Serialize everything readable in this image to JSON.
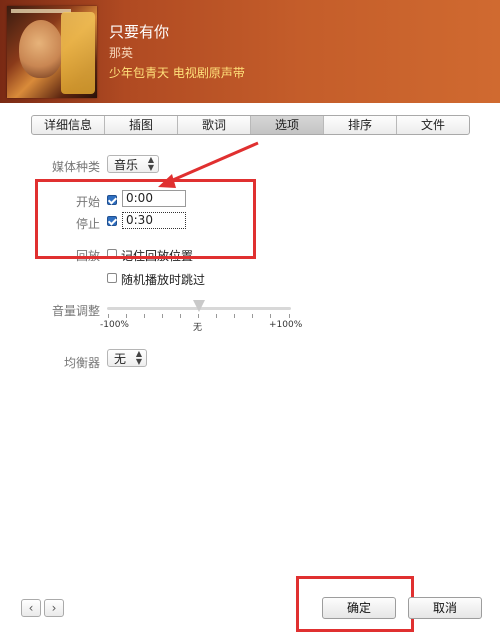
{
  "header": {
    "song_title": "只要有你",
    "artist": "那英",
    "album": "少年包青天 电视剧原声带"
  },
  "tabs": [
    {
      "label": "详细信息",
      "active": false
    },
    {
      "label": "插图",
      "active": false
    },
    {
      "label": "歌词",
      "active": false
    },
    {
      "label": "选项",
      "active": true
    },
    {
      "label": "排序",
      "active": false
    },
    {
      "label": "文件",
      "active": false
    }
  ],
  "options": {
    "media_kind_label": "媒体种类",
    "media_kind_value": "音乐",
    "start_label": "开始",
    "start_checked": true,
    "start_value": "0:00",
    "stop_label": "停止",
    "stop_checked": true,
    "stop_value": "0:30",
    "playback_label": "回放",
    "remember_position_label": "记住回放位置",
    "remember_position_checked": false,
    "skip_shuffle_label": "随机播放时跳过",
    "skip_shuffle_checked": false,
    "volume_label": "音量调整",
    "volume_min_label": "-100%",
    "volume_mid_label": "无",
    "volume_max_label": "+100%",
    "volume_value_percent": 0,
    "equalizer_label": "均衡器",
    "equalizer_value": "无"
  },
  "footer": {
    "prev_icon": "chevron-left-icon",
    "next_icon": "chevron-right-icon",
    "ok_label": "确定",
    "cancel_label": "取消"
  },
  "colors": {
    "annotation_red": "#e03030",
    "header_bg": "#b04a22",
    "album_text": "#ffe07a"
  }
}
